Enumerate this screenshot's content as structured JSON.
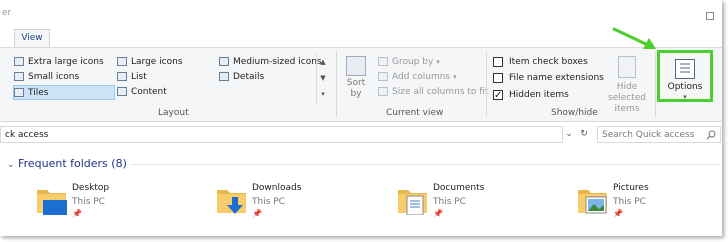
{
  "window": {
    "title_fragment": "er"
  },
  "tabs": [
    {
      "label": "View"
    }
  ],
  "ribbon": {
    "layout": {
      "label": "Layout",
      "items": [
        {
          "label": "Extra large icons"
        },
        {
          "label": "Large icons"
        },
        {
          "label": "Medium-sized icons"
        },
        {
          "label": "Small icons"
        },
        {
          "label": "List"
        },
        {
          "label": "Details"
        },
        {
          "label": "Tiles",
          "selected": true
        },
        {
          "label": "Content"
        }
      ]
    },
    "current_view": {
      "label": "Current view",
      "sort_by": "Sort by",
      "sort_line1": "Sort",
      "sort_line2": "by",
      "group_by": "Group by",
      "add_columns": "Add columns",
      "size_all_columns": "Size all columns to fit"
    },
    "show_hide": {
      "label": "Show/hide",
      "item_check_boxes": {
        "label": "Item check boxes",
        "checked": false
      },
      "file_name_extensions": {
        "label": "File name extensions",
        "checked": false
      },
      "hidden_items": {
        "label": "Hidden items",
        "checked": true
      },
      "hide_selected_line1": "Hide selected",
      "hide_selected_line2": "items"
    },
    "options": {
      "label": "Options",
      "highlight_color": "#4cce2b"
    }
  },
  "address_bar": {
    "value": "ck access"
  },
  "search": {
    "placeholder": "Search Quick access"
  },
  "frequent_folders": {
    "heading": "Frequent folders (8)",
    "items": [
      {
        "name": "Desktop",
        "location": "This PC"
      },
      {
        "name": "Downloads",
        "location": "This PC"
      },
      {
        "name": "Documents",
        "location": "This PC"
      },
      {
        "name": "Pictures",
        "location": "This PC"
      }
    ]
  },
  "colors": {
    "accent": "#1e3287",
    "selected_bg": "#cce4f7",
    "ribbon_bg": "#f5f6f7",
    "annotation_green": "#4cce2b"
  }
}
